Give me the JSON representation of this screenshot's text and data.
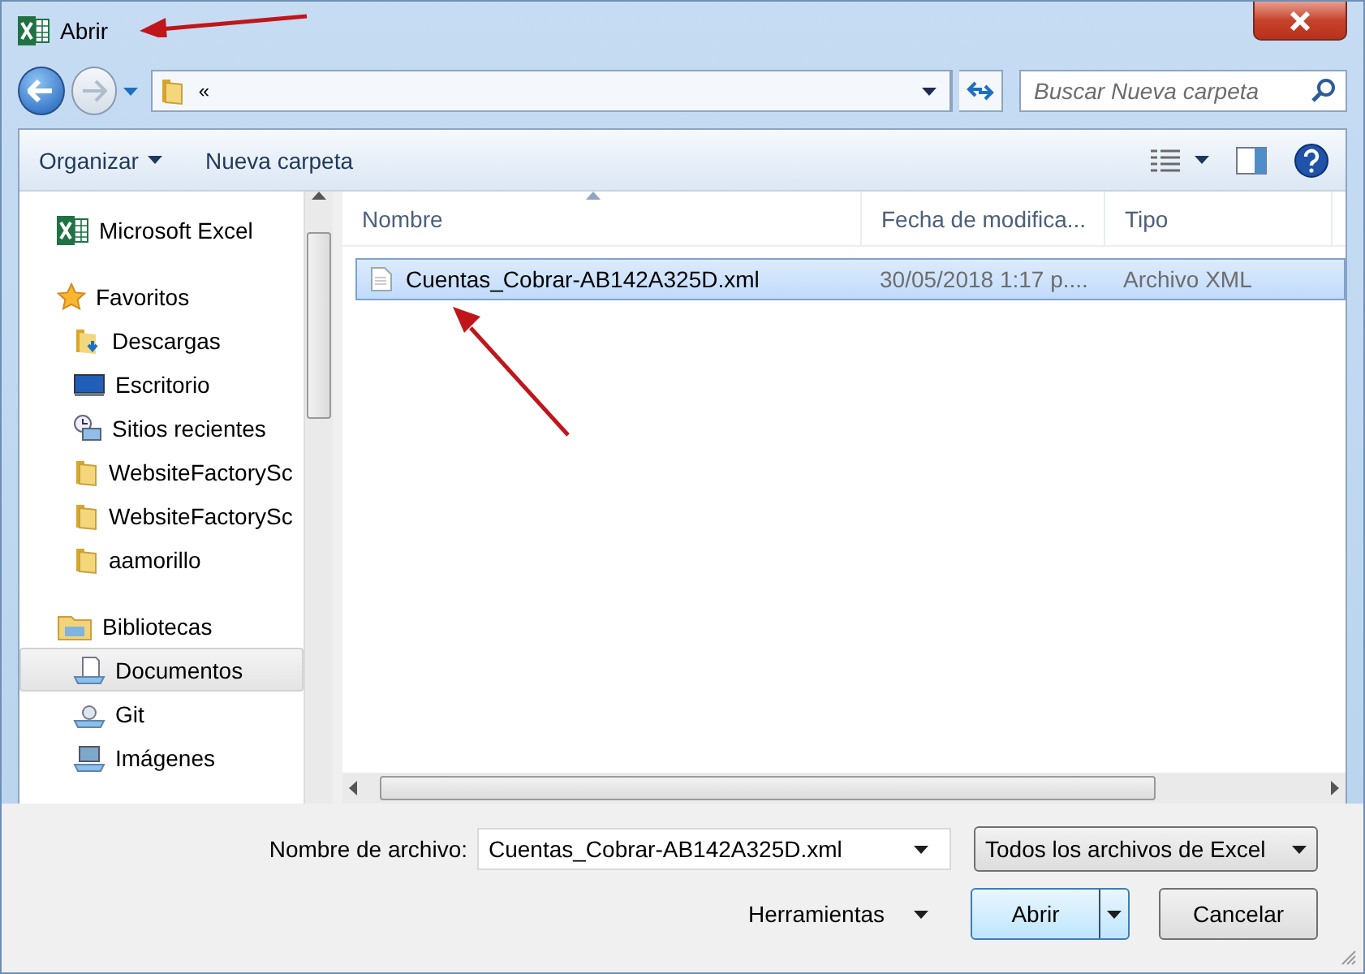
{
  "window": {
    "title": "Abrir"
  },
  "address": {
    "overflow": "«"
  },
  "search": {
    "placeholder": "Buscar Nueva carpeta"
  },
  "toolbar": {
    "items": [
      "Organizar",
      "Nueva carpeta"
    ]
  },
  "sidebar": {
    "items": [
      {
        "kind": "section",
        "label": "Microsoft Excel",
        "selected": false
      },
      {
        "kind": "section",
        "label": "Favoritos",
        "selected": false
      },
      {
        "kind": "item",
        "label": "Descargas",
        "selected": false
      },
      {
        "kind": "item",
        "label": "Escritorio",
        "selected": false
      },
      {
        "kind": "item",
        "label": "Sitios recientes",
        "selected": false
      },
      {
        "kind": "item",
        "label": "WebsiteFactorySc",
        "selected": false
      },
      {
        "kind": "item",
        "label": "WebsiteFactorySc",
        "selected": false
      },
      {
        "kind": "item",
        "label": "aamorillo",
        "selected": false
      },
      {
        "kind": "section",
        "label": "Bibliotecas",
        "selected": false
      },
      {
        "kind": "item",
        "label": "Documentos",
        "selected": true
      },
      {
        "kind": "item",
        "label": "Git",
        "selected": false
      },
      {
        "kind": "item",
        "label": "Imágenes",
        "selected": false
      }
    ]
  },
  "table": {
    "columns": [
      "Nombre",
      "Fecha de modifica...",
      "Tipo"
    ],
    "rows": [
      {
        "cells": [
          "Cuentas_Cobrar-AB142A325D.xml",
          "30/05/2018 1:17 p....",
          "Archivo XML"
        ],
        "selected": true
      }
    ]
  },
  "footer": {
    "filename_label": "Nombre de archivo:",
    "filename": "Cuentas_Cobrar-AB142A325D.xml",
    "filter": "Todos los archivos de Excel",
    "tools": "Herramientas",
    "open": "Abrir",
    "cancel": "Cancelar"
  }
}
